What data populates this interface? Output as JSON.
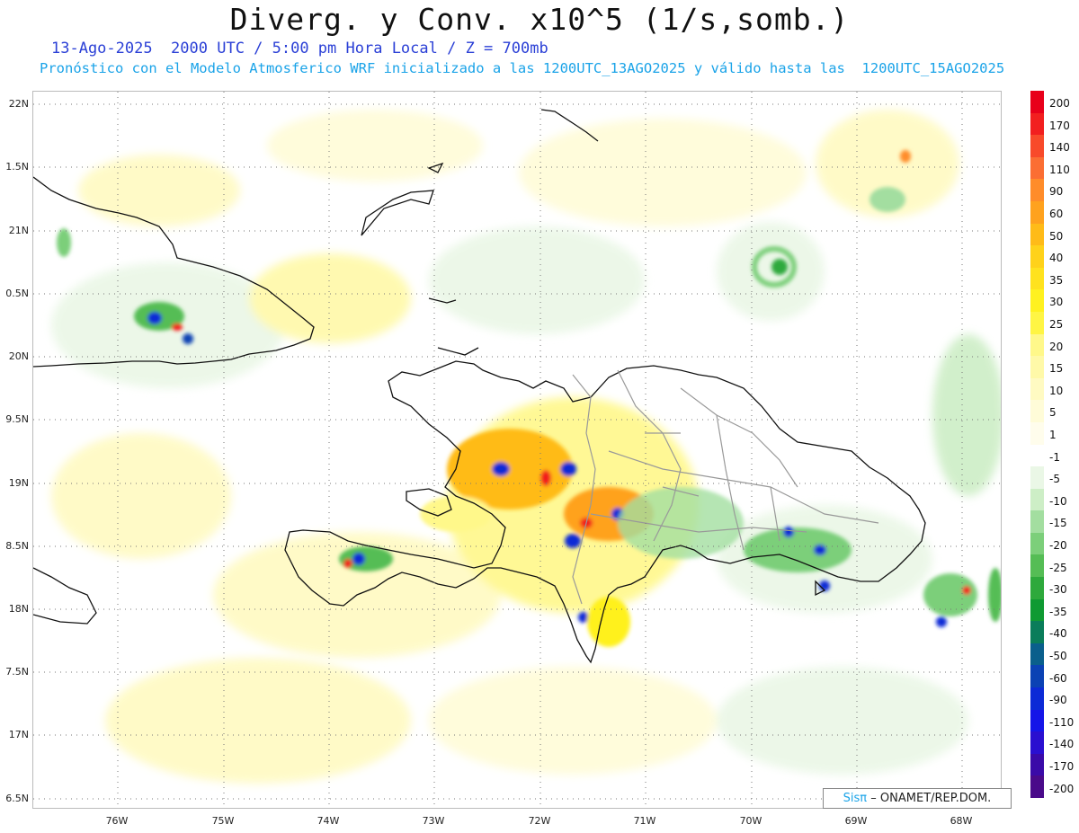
{
  "title": "Diverg. y Conv. x10^5 (1/s,somb.)",
  "subtitle_1": "13-Ago-2025  2000 UTC / 5:00 pm Hora Local / Z = 700mb",
  "subtitle_2": "Pronóstico con el Modelo Atmosferico WRF inicializado a las 1200UTC_13AGO2025 y válido hasta las  1200UTC_15AGO2025",
  "credit": {
    "brand": "Sisπ",
    "rest": "– ONAMET/REP.DOM."
  },
  "lat_labels": [
    "22N",
    "1.5N",
    "21N",
    "0.5N",
    "20N",
    "9.5N",
    "19N",
    "8.5N",
    "18N",
    "7.5N",
    "17N",
    "6.5N"
  ],
  "lon_labels": [
    "76W",
    "75W",
    "74W",
    "73W",
    "72W",
    "71W",
    "70W",
    "69W",
    "68W"
  ],
  "colorbar": {
    "labels": [
      "200",
      "170",
      "140",
      "110",
      "90",
      "60",
      "50",
      "40",
      "35",
      "30",
      "25",
      "20",
      "15",
      "10",
      "5",
      "1",
      "-1",
      "-5",
      "-10",
      "-15",
      "-20",
      "-25",
      "-30",
      "-35",
      "-40",
      "-50",
      "-60",
      "-90",
      "-110",
      "-140",
      "-170",
      "-200"
    ],
    "colors": [
      "#e8001a",
      "#f21f1f",
      "#f84a2a",
      "#fb6e33",
      "#ff8c2a",
      "#ffa21e",
      "#ffbb18",
      "#ffd21a",
      "#ffe21e",
      "#fff11f",
      "#fff544",
      "#fff88a",
      "#fff9a8",
      "#fffac2",
      "#fffcd8",
      "#fffdec",
      "#ffffff",
      "#eaf7e6",
      "#cdeec6",
      "#a3dea0",
      "#7ccf7a",
      "#55bd55",
      "#2ea93c",
      "#0f9a32",
      "#0a7d5a",
      "#0a5f8c",
      "#0b42b4",
      "#0c2ad6",
      "#1515e8",
      "#2a0fd0",
      "#3a0aa8",
      "#4a0a8a"
    ]
  }
}
